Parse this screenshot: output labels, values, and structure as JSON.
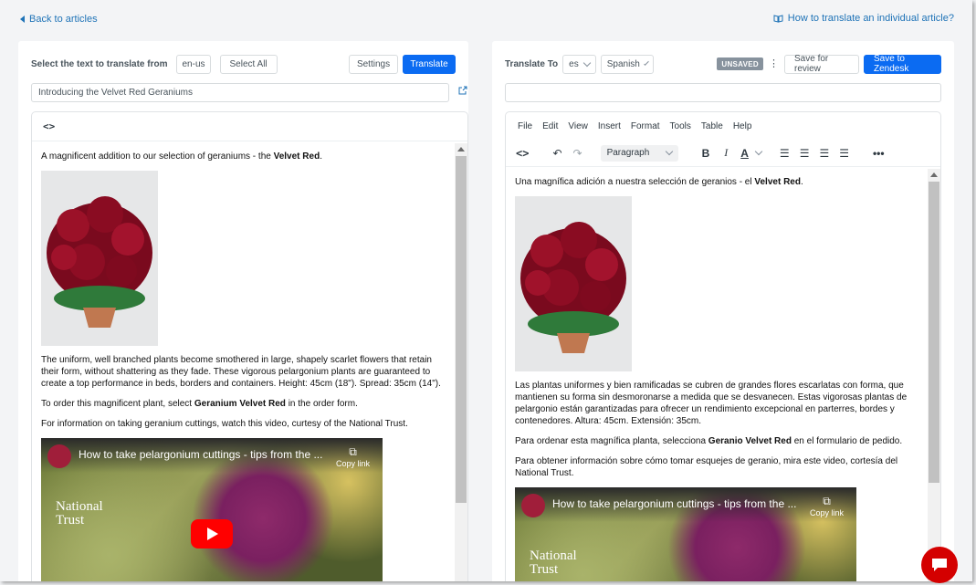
{
  "header": {
    "back_label": "Back to articles",
    "help_label": "How to translate an individual article?"
  },
  "source": {
    "select_label": "Select the text to translate from",
    "locale": "en-us",
    "select_all": "Select All",
    "settings": "Settings",
    "translate": "Translate",
    "title_value": "Introducing the Velvet Red Geraniums",
    "para1_pre": "A magnificent addition to our selection of geraniums - the ",
    "para1_bold": "Velvet Red",
    "para1_post": ".",
    "para2": "The uniform, well branched plants become smothered in large, shapely scarlet flowers that retain their form, without shattering as they fade. These vigorous pelargonium plants are guaranteed to create a top performance in beds, borders and containers. Height: 45cm (18\"). Spread: 35cm (14\").",
    "para3_pre": "To order this magnificent plant, select ",
    "para3_bold": "Geranium Velvet Red",
    "para3_post": " in the order form.",
    "para4": "For information on taking geranium cuttings, watch this video, curtesy of the National Trust."
  },
  "target": {
    "translate_to_label": "Translate To",
    "lang_code": "es",
    "lang_name": "Spanish",
    "status_badge": "UNSAVED",
    "save_review": "Save for review",
    "save_zendesk": "Save to Zendesk",
    "title_value": "",
    "menu": [
      "File",
      "Edit",
      "View",
      "Insert",
      "Format",
      "Tools",
      "Table",
      "Help"
    ],
    "format_select": "Paragraph",
    "para1_pre": "Una magnífica adición a nuestra selección de geranios - el ",
    "para1_bold": "Velvet Red",
    "para1_post": ".",
    "para2": "Las plantas uniformes y bien ramificadas se cubren de grandes flores escarlatas con forma, que mantienen su forma sin desmoronarse a medida que se desvanecen. Estas vigorosas plantas de pelargonio están garantizadas para ofrecer un rendimiento excepcional en parterres, bordes y contenedores. Altura: 45cm. Extensión: 35cm.",
    "para3_pre": "Para ordenar esta magnífica planta, selecciona ",
    "para3_bold": "Geranio Velvet Red",
    "para3_post": " en el formulario de pedido.",
    "para4": "Para obtener información sobre cómo tomar esquejes de geranio, mira este video, cortesía del National Trust."
  },
  "video": {
    "title": "How to take pelargonium cuttings - tips from the ...",
    "copy_link": "Copy link",
    "brand_line1": "National",
    "brand_line2": "Trust"
  },
  "colors": {
    "primary": "#1f73b7",
    "save_blue": "#0b6bf2",
    "chat_red": "#d40000"
  }
}
